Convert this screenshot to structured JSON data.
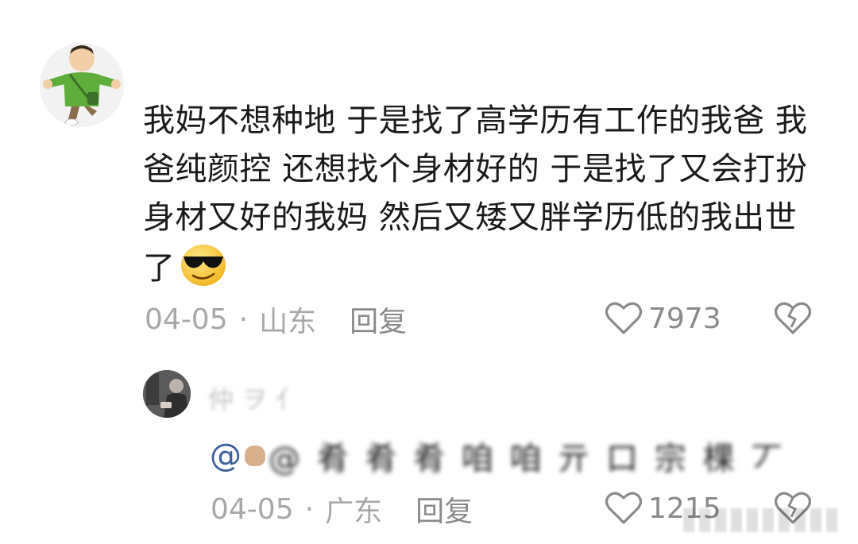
{
  "comment": {
    "text": "我妈不想种地 于是找了高学历有工作的我爸  我爸纯颜控 还想找个身材好的 于是找了又会打扮身材又好的我妈  然后又矮又胖学历低的我出世了",
    "emoji": "sunglasses-face-icon",
    "date": "04-05",
    "separator": "·",
    "location": "山东",
    "reply_label": "回复",
    "likes": "7973"
  },
  "reply": {
    "name": "仲 ヲ 亻",
    "at_symbol": "@",
    "mention_text": "@ 肴 肴 肴 咱 咱 亓 口 宗 棵 丆",
    "date": "04-05",
    "separator": "·",
    "location": "广东",
    "reply_label": "回复",
    "likes": "1215"
  },
  "colors": {
    "text": "#1a1a1a",
    "meta": "#a8a8a8",
    "mention": "#3b5f9a",
    "icon": "#8a8a8a"
  }
}
